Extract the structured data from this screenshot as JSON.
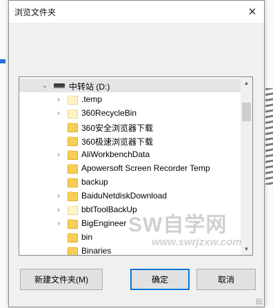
{
  "dialog": {
    "title": "浏览文件夹",
    "close_glyph": "✕"
  },
  "tree": {
    "root": {
      "label": "中转站 (D:)",
      "expanded": true,
      "icon": "drive-icon"
    },
    "items": [
      {
        "label": ".temp",
        "expandable": true,
        "folder_color": "#fff3c6"
      },
      {
        "label": "360RecycleBin",
        "expandable": true,
        "folder_color": "#fff3c6"
      },
      {
        "label": "360安全浏览器下载",
        "expandable": false,
        "folder_color": "#f7cf57"
      },
      {
        "label": "360极速浏览器下载",
        "expandable": false,
        "folder_color": "#f7cf57"
      },
      {
        "label": "AliWorkbenchData",
        "expandable": true,
        "folder_color": "#f7cf57"
      },
      {
        "label": "Apowersoft Screen Recorder Temp",
        "expandable": false,
        "folder_color": "#f7cf57"
      },
      {
        "label": "backup",
        "expandable": false,
        "folder_color": "#f7cf57"
      },
      {
        "label": "BaiduNetdiskDownload",
        "expandable": true,
        "folder_color": "#f7cf57"
      },
      {
        "label": "bbtToolBackUp",
        "expandable": true,
        "folder_color": "#fff3c6"
      },
      {
        "label": "BigEngineer",
        "expandable": true,
        "folder_color": "#f7cf57"
      },
      {
        "label": "bin",
        "expandable": false,
        "folder_color": "#f7cf57"
      },
      {
        "label": "Binaries",
        "expandable": false,
        "folder_color": "#f7cf57"
      }
    ],
    "chevron_right": "›",
    "chevron_down": "⌄"
  },
  "scrollbar": {
    "up_glyph": "▲",
    "down_glyph": "▼",
    "position_fraction": 0.1,
    "visible_fraction": 0.12
  },
  "buttons": {
    "new_folder": "新建文件夹(M)",
    "ok": "确定",
    "cancel": "取消"
  },
  "watermark": {
    "main": "SW自学网",
    "sub": "www.swrjzxw.com"
  },
  "colors": {
    "selection": "#e5e5e5",
    "accent": "#0078d7",
    "folder": "#f7cf57",
    "folder_hidden": "#fff3c6"
  }
}
